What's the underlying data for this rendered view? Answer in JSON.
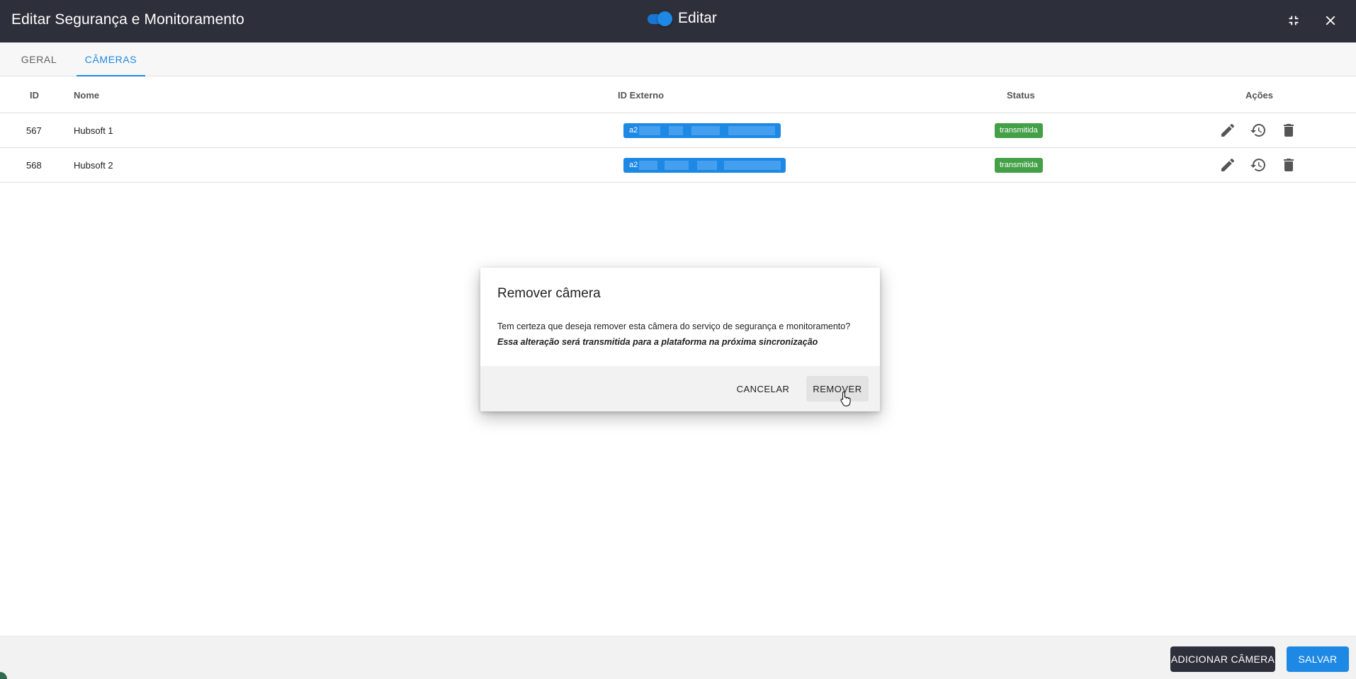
{
  "window": {
    "title": "Editar Segurança e Monitoramento",
    "edit_toggle": {
      "label": "Editar",
      "on": true
    }
  },
  "tabs": [
    {
      "label": "GERAL",
      "active": false
    },
    {
      "label": "CÂMERAS",
      "active": true
    }
  ],
  "table": {
    "columns": [
      "ID",
      "Nome",
      "ID Externo",
      "Status",
      "Ações"
    ],
    "rows": [
      {
        "id": "567",
        "name": "Hubsoft 1",
        "external_id": "a2",
        "status": "transmitida"
      },
      {
        "id": "568",
        "name": "Hubsoft 2",
        "external_id": "a2",
        "status": "transmitida"
      }
    ],
    "action_icons": [
      "edit-icon",
      "history-icon",
      "delete-icon"
    ]
  },
  "dialog": {
    "title": "Remover câmera",
    "message": "Tem certeza que deseja remover esta câmera do serviço de segurança e monitoramento?",
    "note": "Essa alteração será transmitida para a plataforma na próxima sincronização",
    "cancel_label": "CANCELAR",
    "remove_label": "REMOVER"
  },
  "footer": {
    "add_label": "ADICIONAR CÂMERA",
    "save_label": "SALVAR"
  },
  "colors": {
    "titlebar": "#2d2f3a",
    "accent": "#1e88e5",
    "status_ok": "#43a047"
  }
}
